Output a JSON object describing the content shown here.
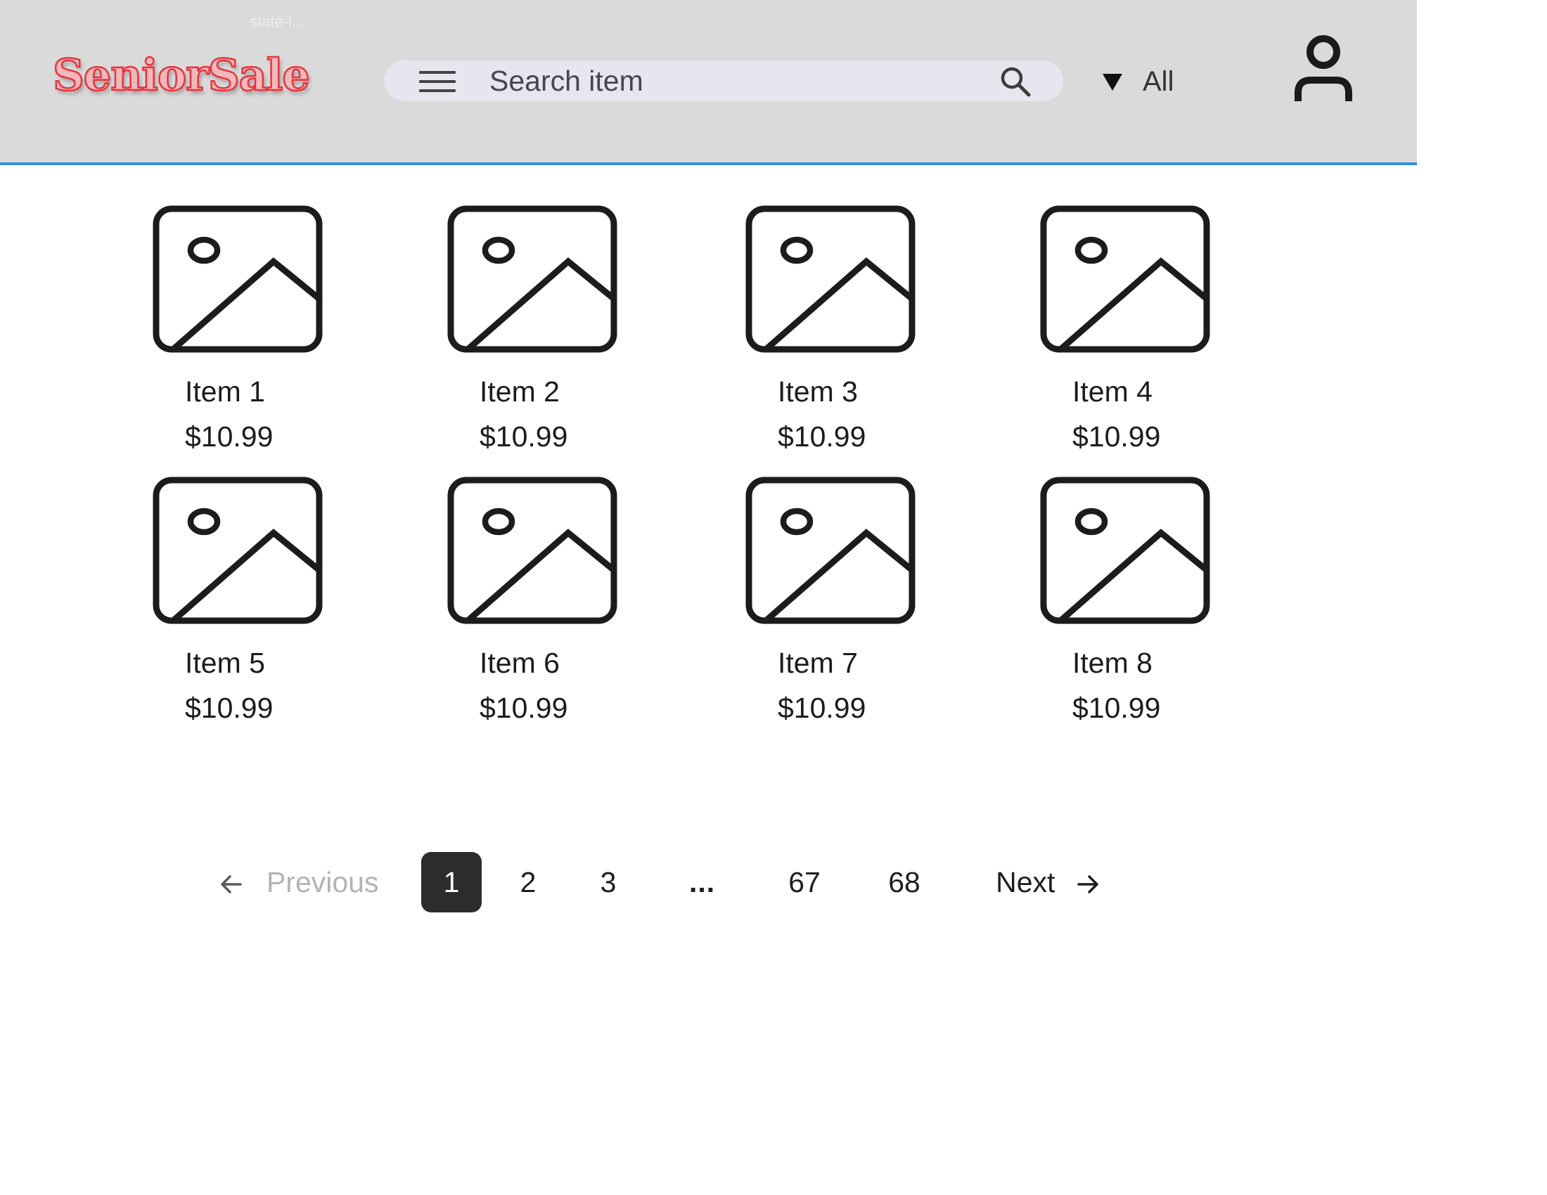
{
  "header": {
    "ghost_text": "state-l...",
    "logo": "SeniorSale",
    "search": {
      "placeholder": "Search item"
    },
    "filter": {
      "selected": "All"
    },
    "colors": {
      "header_bg": "#dadada",
      "accent_border": "#2f8fe6",
      "logo_red": "#e8343c"
    }
  },
  "products": [
    {
      "name": "Item 1",
      "price": "$10.99"
    },
    {
      "name": "Item 2",
      "price": "$10.99"
    },
    {
      "name": "Item 3",
      "price": "$10.99"
    },
    {
      "name": "Item 4",
      "price": "$10.99"
    },
    {
      "name": "Item 5",
      "price": "$10.99"
    },
    {
      "name": "Item 6",
      "price": "$10.99"
    },
    {
      "name": "Item 7",
      "price": "$10.99"
    },
    {
      "name": "Item 8",
      "price": "$10.99"
    }
  ],
  "pagination": {
    "previous_label": "Previous",
    "next_label": "Next",
    "pages": [
      "1",
      "2",
      "3",
      "67",
      "68"
    ],
    "ellipsis": "...",
    "current_page": "1"
  },
  "icons": {
    "menu": "hamburger-menu-icon",
    "search": "search-icon",
    "account": "user-account-icon",
    "filter": "triangle-down-icon",
    "thumbnail": "image-placeholder-icon",
    "previous": "arrow-left-icon",
    "next": "arrow-right-icon"
  }
}
